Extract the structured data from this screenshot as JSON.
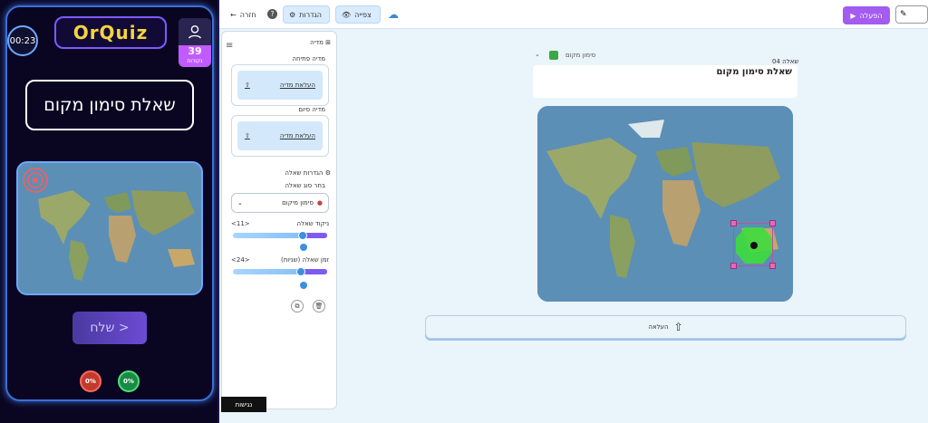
{
  "phone": {
    "timer": "00:23",
    "logo": "OrQuiz",
    "score": "39",
    "score_label": "נקודות",
    "question_title": "שאלת סימון מקום",
    "send_label": "שלח >",
    "pct_wrong": "0%",
    "pct_right": "0%"
  },
  "topbar": {
    "back_label": "חזרה",
    "settings_label": "הגדרות",
    "preview_label": "צפייה",
    "run_label": "הפעלה"
  },
  "panel": {
    "media_title": "מדיה",
    "opening_media_label": "מדיה פתיחה",
    "upload_media_label": "העלאת מדיה",
    "end_media_label": "מדיה סיום",
    "upload_media_label_2": "העלאת מדיה",
    "question_settings_title": "הגדרות שאלה",
    "choose_type_label": "בחר סוג שאלה",
    "question_type_value": "סימון מיקום",
    "score_slider_label": "ניקוד שאלה",
    "score_slider_value": "<11>",
    "time_slider_label": "זמן שאלה (שניות)",
    "time_slider_value": "<24>",
    "tabs_label": "נגישות"
  },
  "main": {
    "qtype_label": "סימון מקום",
    "question_number": "שאלה 04",
    "question_text": "שאלת סימון מקום",
    "upload_label": "העלאה"
  },
  "colors": {
    "accent": "#a35bf0",
    "primary": "#3d8fe0",
    "marker": "#3ddc3d"
  }
}
